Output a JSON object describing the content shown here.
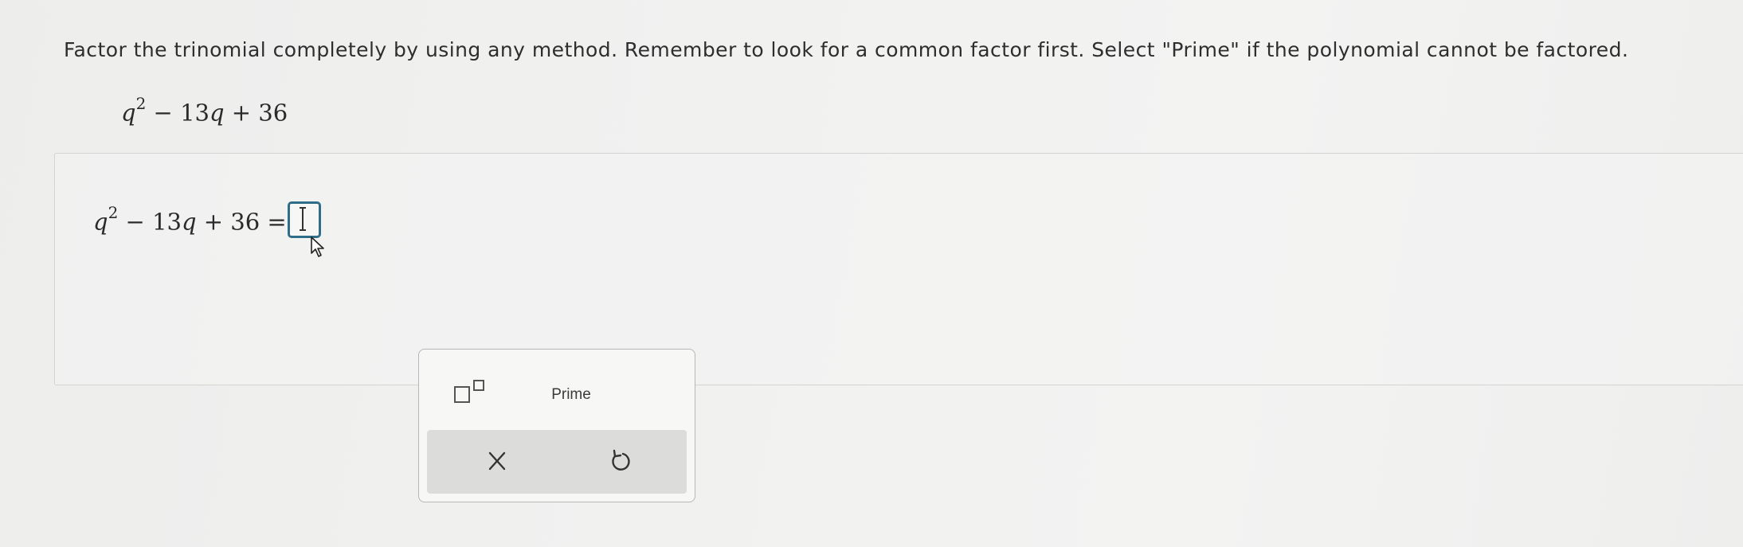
{
  "question": {
    "instructions": "Factor the trinomial completely by using any method. Remember to look for a common factor first. Select \"Prime\" if the polynomial cannot be factored.",
    "expression": {
      "var1": "q",
      "exp": "2",
      "op1": "−",
      "term2": "13",
      "var2": "q",
      "op2": "+",
      "term3": "36"
    }
  },
  "answer": {
    "expression": {
      "var1": "q",
      "exp": "2",
      "op1": "−",
      "term2": "13",
      "var2": "q",
      "op2": "+",
      "term3": "36",
      "equals": "="
    },
    "input_value": ""
  },
  "toolbar": {
    "prime_label": "Prime",
    "exponent_icon": "superscript-template-icon",
    "clear_icon": "close-icon",
    "undo_icon": "undo-icon"
  },
  "colors": {
    "answer_box_border": "#2f6e8a",
    "action_bar_bg": "#dcdcdb",
    "icon_color": "#333333"
  }
}
